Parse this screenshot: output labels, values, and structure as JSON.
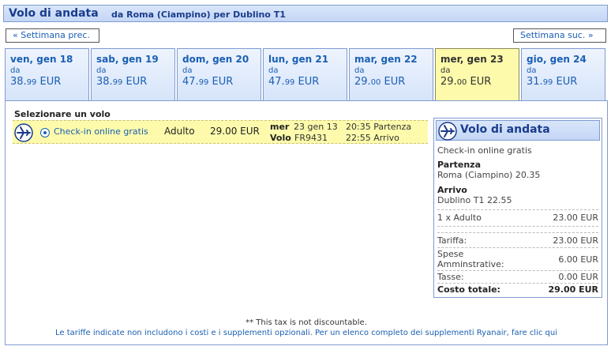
{
  "header": {
    "title": "Volo di andata",
    "route": "da Roma (Ciampino) per Dublino T1"
  },
  "nav": {
    "prev_label": "« Settimana prec.",
    "next_label": "Settimana suc. »"
  },
  "tabs": [
    {
      "day": "ven, gen 18",
      "da": "da",
      "price_main": "38.",
      "price_cents": "99",
      "currency": " EUR"
    },
    {
      "day": "sab, gen 19",
      "da": "da",
      "price_main": "38.",
      "price_cents": "99",
      "currency": " EUR"
    },
    {
      "day": "dom, gen 20",
      "da": "da",
      "price_main": "47.",
      "price_cents": "99",
      "currency": " EUR"
    },
    {
      "day": "lun, gen 21",
      "da": "da",
      "price_main": "47.",
      "price_cents": "99",
      "currency": " EUR"
    },
    {
      "day": "mar, gen 22",
      "da": "da",
      "price_main": "29.",
      "price_cents": "00",
      "currency": " EUR"
    },
    {
      "day": "mer, gen 23",
      "da": "da",
      "price_main": "29.",
      "price_cents": "00",
      "currency": " EUR"
    },
    {
      "day": "gio, gen 24",
      "da": "da",
      "price_main": "31.",
      "price_cents": "99",
      "currency": " EUR"
    }
  ],
  "selected_tab_index": 5,
  "select_title": "Selezionare un volo",
  "flight": {
    "fare_label": "Check-in online gratis",
    "passenger": "Adulto",
    "price": "29.00 EUR",
    "day": "mer",
    "date": "23 gen 13",
    "volo_label": "Volo",
    "flight_number": "FR9431",
    "departure": "20:35 Partenza",
    "arrival": "22:55 Arrivo"
  },
  "summary": {
    "title": "Volo di andata",
    "fare": "Check-in online gratis",
    "departure_label": "Partenza",
    "departure_value": "Roma (Ciampino) 20.35",
    "arrival_label": "Arrivo",
    "arrival_value": "Dublino T1 22.55",
    "pax_line": "1 x Adulto",
    "pax_amount": "23.00 EUR",
    "tariffa_label": "Tariffa:",
    "tariffa_amount": "23.00 EUR",
    "spese_label_1": "Spese",
    "spese_label_2": "Amminstrative:",
    "spese_amount": "6.00 EUR",
    "tasse_label": "Tasse:",
    "tasse_amount": "0.00 EUR",
    "total_label": "Costo totale:",
    "total_amount": "29.00 EUR"
  },
  "footer": {
    "note": "** This tax is not discountable.",
    "link": "Le tariffe indicate non includono i costi e i supplementi opzionali. Per un elenco completo dei supplementi Ryanair, fare clic qui"
  },
  "icons": {
    "plane": "plane-icon"
  },
  "colors": {
    "accent": "#1a5fb4",
    "selected_bg": "#fdfbab",
    "header_bg": "#c4d6f5"
  }
}
